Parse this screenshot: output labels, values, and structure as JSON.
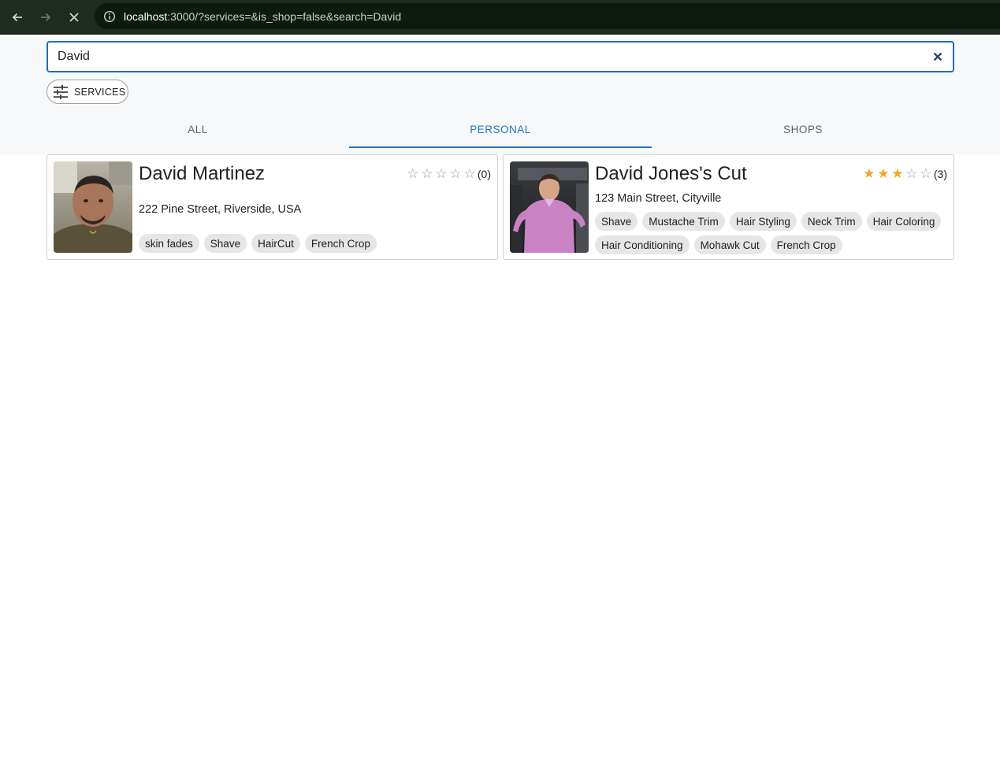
{
  "browser": {
    "url_host": "localhost",
    "url_rest": ":3000/?services=&is_shop=false&search=David"
  },
  "search": {
    "value": "David",
    "placeholder": ""
  },
  "filters": {
    "services_label": "SERVICES"
  },
  "tabs": [
    {
      "label": "ALL",
      "active": false
    },
    {
      "label": "PERSONAL",
      "active": true
    },
    {
      "label": "SHOPS",
      "active": false
    }
  ],
  "colors": {
    "accent": "#1e74c8",
    "star_filled": "#f5a623",
    "star_empty": "#9e9e9e"
  },
  "results": [
    {
      "name": "David Martinez",
      "rating": 0,
      "rating_max": 5,
      "rating_count": "(0)",
      "address": "222 Pine Street, Riverside, USA",
      "services": [
        "skin fades",
        "Shave",
        "HairCut",
        "French Crop"
      ]
    },
    {
      "name": "David Jones's Cut",
      "rating": 3,
      "rating_max": 5,
      "rating_count": "(3)",
      "address": "123 Main Street, Cityville",
      "services": [
        "Shave",
        "Mustache Trim",
        "Hair Styling",
        "Neck Trim",
        "Hair Coloring",
        "Hair Conditioning",
        "Mohawk Cut",
        "French Crop"
      ]
    }
  ]
}
